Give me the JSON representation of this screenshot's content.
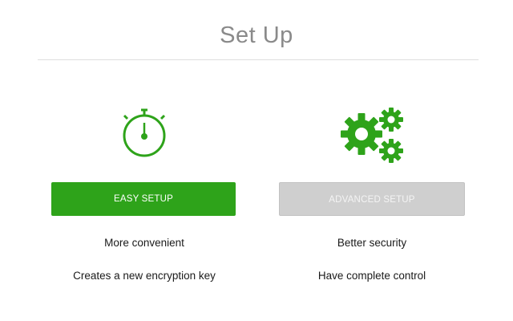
{
  "page": {
    "title": "Set Up"
  },
  "easy": {
    "icon": "stopwatch-icon",
    "button_label": "EASY SETUP",
    "benefit": "More convenient",
    "description": "Creates a new encryption key"
  },
  "advanced": {
    "icon": "gears-icon",
    "button_label": "ADVANCED SETUP",
    "benefit": "Better security",
    "description": "Have complete control"
  },
  "colors": {
    "accent": "#2ea31a",
    "disabled_button": "#cfcfcf",
    "title": "#8a8a8a"
  }
}
